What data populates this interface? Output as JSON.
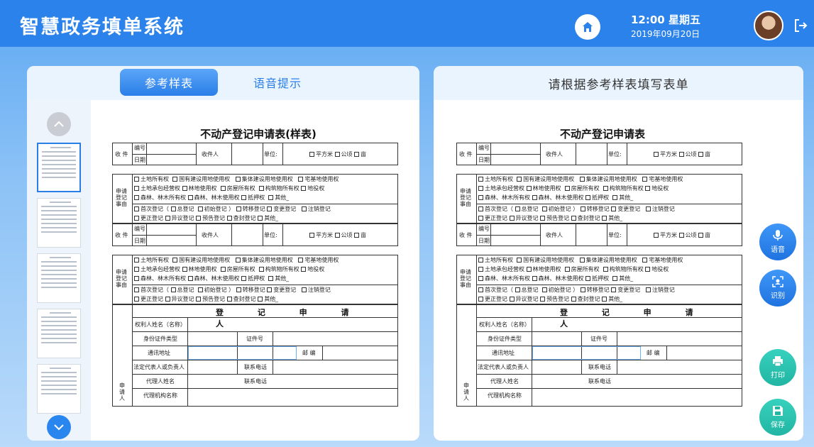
{
  "header": {
    "title": "智慧政务填单系统",
    "time": "12:00 星期五",
    "date": "2019年09月20日",
    "home_icon": "home-icon",
    "logout_icon": "logout-icon"
  },
  "left_panel": {
    "tabs": [
      {
        "label": "参考样表",
        "active": true
      },
      {
        "label": "语音提示",
        "active": false
      }
    ],
    "form_title": "不动产登记申请表(样表)"
  },
  "right_panel": {
    "title": "请根据参考样表填写表单",
    "form_title": "不动产登记申请表"
  },
  "form": {
    "receive": "收 件",
    "number": "编号",
    "date": "日期",
    "receiver": "收件人",
    "unit": "单位:",
    "units": [
      "平方米",
      "公顷",
      "亩"
    ],
    "apply_matter": "申请登记事由",
    "rights_row1": [
      "土地所有权",
      "国有建设用地使用权",
      "集体建设用地使用权",
      "宅基地使用权"
    ],
    "rights_row2": [
      "土地承包经营权",
      "林地使用权",
      "房屋所有权",
      "构筑物所有权",
      "地役权"
    ],
    "rights_row3": [
      "森林、林木所有权",
      "森林、林木使用权",
      "抵押权",
      "其他_"
    ],
    "reg_row1": [
      "首次登记（",
      "总登记",
      "初始登记 ）",
      "转移登记",
      "变更登记",
      "注销登记"
    ],
    "reg_row2": [
      "更正登记",
      "异议登记",
      "预告登记",
      "查封登记",
      "其他_"
    ],
    "applicant_header": "登 记 申 请 人",
    "applicant_side": "申请人",
    "fields": {
      "owner_name": "权利人姓名（名称）",
      "id_type": "身份证件类型",
      "id_no": "证件号",
      "address": "通讯地址",
      "zip": "邮 编",
      "legal_rep": "法定代表人或负责人",
      "phone": "联系电话",
      "agent_name": "代理人姓名",
      "agency_name": "代理机构名称"
    }
  },
  "side_buttons": [
    {
      "label": "语音",
      "icon": "microphone-icon"
    },
    {
      "label": "识别",
      "icon": "scan-icon"
    },
    {
      "label": "打印",
      "icon": "printer-icon"
    },
    {
      "label": "保存",
      "icon": "save-icon"
    }
  ]
}
